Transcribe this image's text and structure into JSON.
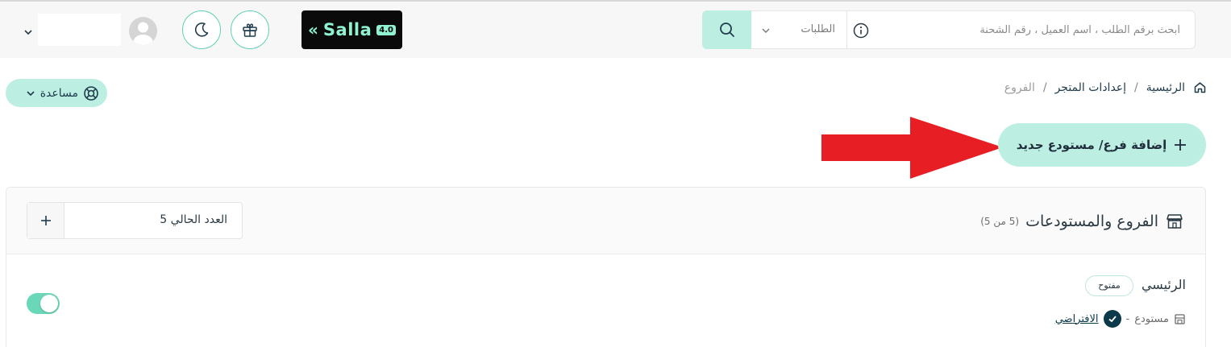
{
  "header": {
    "search": {
      "placeholder": "ابحث برقم الطلب ، اسم العميل ، رقم الشحنة"
    },
    "search_type": {
      "selected": "الطلبات"
    },
    "logo": {
      "text": "Salla",
      "version": "4.0"
    }
  },
  "breadcrumb": {
    "items": [
      "الرئيسية",
      "إعدادات المتجر",
      "الفروع"
    ],
    "separator": "/"
  },
  "help": {
    "label": "مساعدة"
  },
  "add_branch": {
    "label": "إضافة فرع/ مستودع جديد"
  },
  "branches_card": {
    "title": "الفروع والمستودعات",
    "count_badge": "(5 من 5)",
    "current_count": "العدد الحالي 5"
  },
  "branch": {
    "name": "الرئيسي",
    "status": "مفتوح",
    "type": "مستودع",
    "dash": "-",
    "default_label": "الافتراضي",
    "enabled": true
  },
  "colors": {
    "accent": "#bcefe2",
    "accent_border": "#62d0b3",
    "arrow": "#e81e25",
    "dark": "#0c3a4a"
  }
}
